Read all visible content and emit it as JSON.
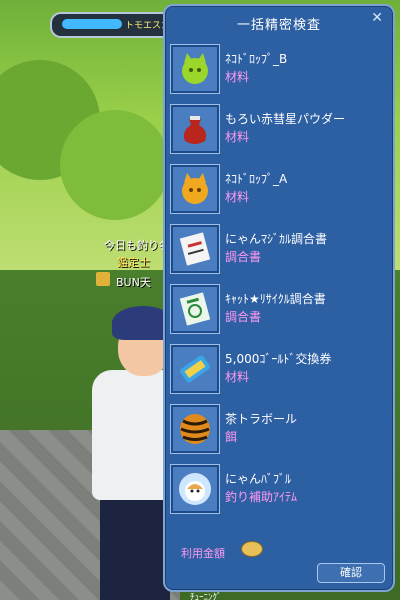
{
  "hud": {
    "player_name": "トモエスカ"
  },
  "chat": {
    "line1": "今日も釣り名",
    "line2": "鑑定士",
    "line3": "BUN天"
  },
  "bottom_text": "ﾁｭｰﾆﾝｸﾞ",
  "dialog": {
    "title": "一括精密検査",
    "close_glyph": "✕",
    "items": [
      {
        "name": "ﾈｺﾄﾞﾛｯﾌﾟ_B",
        "category": "材料",
        "icon": "green-cat-drop-icon"
      },
      {
        "name": "もろい赤彗星パウダー",
        "category": "材料",
        "icon": "red-powder-bag-icon"
      },
      {
        "name": "ﾈｺﾄﾞﾛｯﾌﾟ_A",
        "category": "材料",
        "icon": "yellow-cat-drop-icon"
      },
      {
        "name": "にゃんﾏｼﾞｶﾙ調合書",
        "category": "調合書",
        "icon": "recipe-scroll-icon"
      },
      {
        "name": "ｷｬｯﾄ★ﾘｻｲｸﾙ調合書",
        "category": "調合書",
        "icon": "recycle-scroll-icon"
      },
      {
        "name": "5,000ｺﾞｰﾙﾄﾞ交換券",
        "category": "材料",
        "icon": "gold-ticket-icon"
      },
      {
        "name": "茶トラボール",
        "category": "餌",
        "icon": "tiger-ball-icon"
      },
      {
        "name": "にゃんﾊﾞﾌﾞﾙ",
        "category": "釣り補助ｱｲﾃﾑ",
        "icon": "cat-bubble-icon"
      }
    ],
    "fee_label": "利用金額",
    "confirm_label": "確認"
  },
  "colors": {
    "panel_bg": "#2d5fa3",
    "category_text": "#ff9af0"
  }
}
